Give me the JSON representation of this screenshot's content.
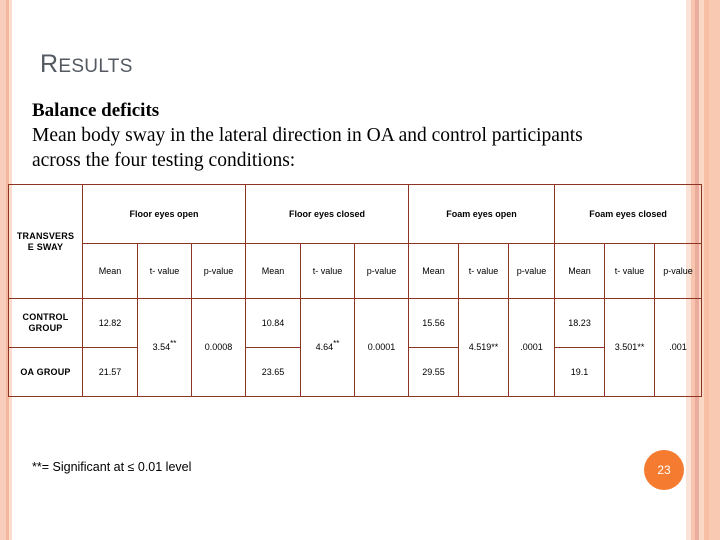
{
  "slide": {
    "title_first_letter": "R",
    "title_rest": "ESULTS",
    "title_color": "#545a62",
    "accent_color": "#f47b30",
    "table_border_color": "#8c3523",
    "stripe_color": "#f9c9b2"
  },
  "body": {
    "lead": "Balance deficits",
    "line1": "Mean body sway in the lateral direction in OA and control participants",
    "line2": "across the four testing conditions:"
  },
  "table": {
    "corner_label_line1": "TRANSVERS",
    "corner_label_line2": "E SWAY",
    "groups": [
      {
        "label": "Floor eyes open",
        "sub": [
          "Mean",
          "t- value",
          "p-value"
        ]
      },
      {
        "label": "Floor eyes closed",
        "sub": [
          "Mean",
          "t- value",
          "p-value"
        ]
      },
      {
        "label": "Foam eyes open",
        "sub": [
          "Mean",
          "t- value",
          "p-value"
        ]
      },
      {
        "label": "Foam eyes closed",
        "sub": [
          "Mean",
          "t- value",
          "p-value"
        ]
      }
    ],
    "rows": [
      {
        "label": "CONTROL GROUP",
        "label_line1": "CONTROL",
        "label_line2": "GROUP",
        "means": [
          "12.82",
          "10.84",
          "15.56",
          "18.23"
        ]
      },
      {
        "label": "OA GROUP",
        "label_line1": "OA GROUP",
        "label_line2": "",
        "means": [
          "21.57",
          "23.65",
          "29.55",
          "19.1"
        ]
      }
    ],
    "stats": [
      {
        "t_value": "3.54",
        "t_marker": "**",
        "p_value": "0.0008"
      },
      {
        "t_value": "4.64",
        "t_marker": "**",
        "p_value": "0.0001"
      },
      {
        "t_value": "4.519",
        "t_marker": "**",
        "p_value": ".0001"
      },
      {
        "t_value": "3.501",
        "t_marker": "**",
        "p_value": ".001"
      }
    ]
  },
  "footnote": "**= Significant at ≤ 0.01 level",
  "page_number": "23"
}
